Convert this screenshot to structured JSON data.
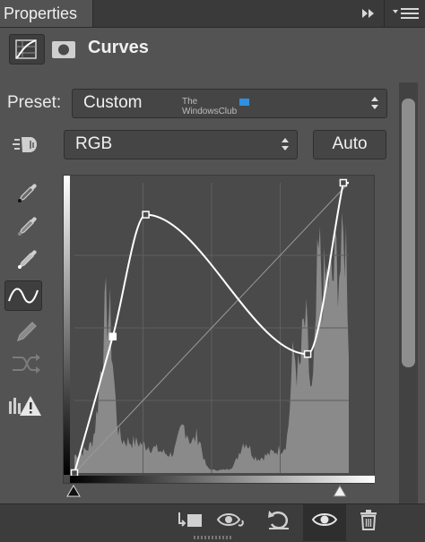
{
  "panel": {
    "tab_title": "Properties",
    "menu_icons": [
      "forward-double-arrow-icon",
      "panel-menu-icon"
    ]
  },
  "adjustment": {
    "title": "Curves",
    "icons": [
      "curves-adjustment-icon",
      "layer-mask-icon"
    ]
  },
  "preset": {
    "label": "Preset:",
    "value": "Custom"
  },
  "watermark": {
    "line1": "The",
    "line2": "WindowsClub"
  },
  "channel": {
    "value": "RGB"
  },
  "auto_button": {
    "label": "Auto"
  },
  "tools": [
    "on-image-adjust-icon",
    "black-point-eyedropper-icon",
    "gray-point-eyedropper-icon",
    "white-point-eyedropper-icon",
    "curve-points-icon",
    "pencil-draw-icon",
    "smooth-curve-icon",
    "clipping-warning-icon"
  ],
  "active_tool": "curve-points-icon",
  "curve": {
    "control_points": [
      {
        "input": 0,
        "output": 0
      },
      {
        "input": 14,
        "output": 47
      },
      {
        "input": 26,
        "output": 89
      },
      {
        "input": 85,
        "output": 41
      },
      {
        "input": 98,
        "output": 100
      }
    ],
    "input_black_slider": 0,
    "input_white_slider": 97
  },
  "bottom_bar": {
    "icons": [
      "clip-to-layer-icon",
      "view-previous-state-icon",
      "reset-icon",
      "visibility-eye-icon",
      "trash-icon"
    ]
  },
  "colors": {
    "panel_bg": "#535353",
    "curve": "#ffffff",
    "histogram": "#8a8a8a"
  }
}
